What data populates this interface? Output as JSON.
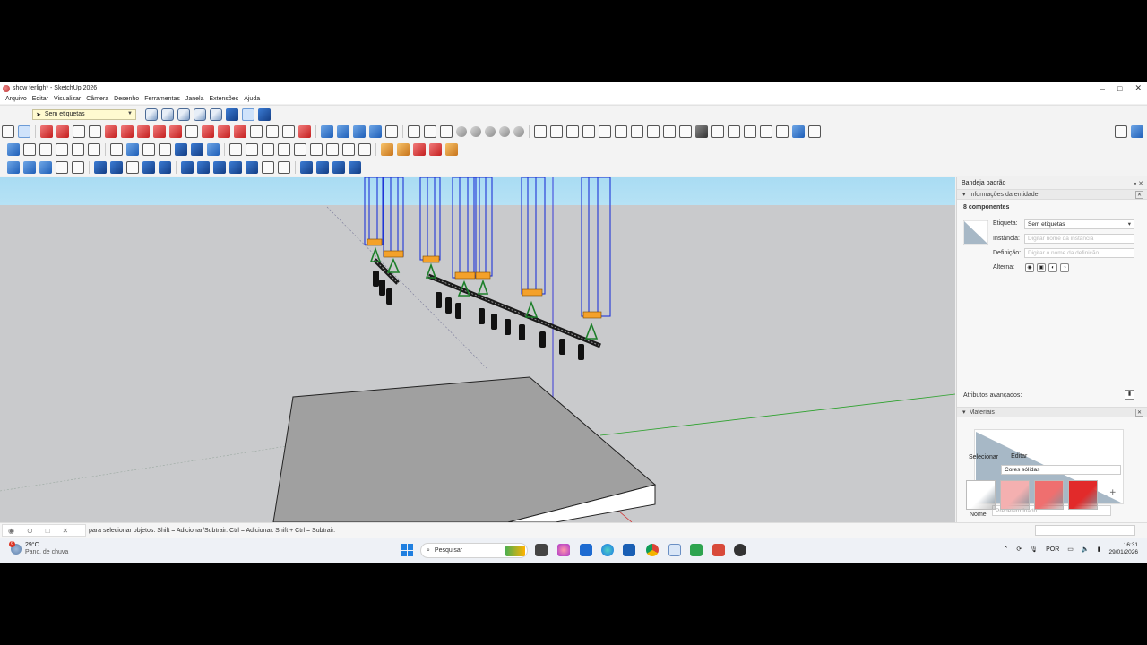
{
  "window": {
    "title": "show ferligh* - SketchUp 2026"
  },
  "menu": [
    "Arquivo",
    "Editar",
    "Visualizar",
    "Câmera",
    "Desenho",
    "Ferramentas",
    "Janela",
    "Extensões",
    "Ajuda"
  ],
  "toolbar": {
    "tag_select_value": "Sem etiquetas"
  },
  "status": {
    "hint": "para selecionar objetos. Shift = Adicionar/Subtrair. Ctrl = Adicionar. Shift + Ctrl = Subtrair."
  },
  "tray": {
    "title": "Bandeja padrão",
    "entity_panel": {
      "title": "Informações da entidade",
      "count": "8 componentes",
      "tag_label": "Etiqueta:",
      "tag_value": "Sem etiquetas",
      "instance_label": "Instância:",
      "instance_placeholder": "Digitar nome da instância",
      "definition_label": "Definição:",
      "definition_placeholder": "Digitar o nome da definição",
      "toggles_label": "Alterna:",
      "advanced_label": "Atributos avançados:"
    },
    "materials_panel": {
      "title": "Materiais",
      "name_label": "Nome",
      "name_placeholder": "Predeterminado",
      "tab_select": "Selecionar",
      "tab_edit": "Editar",
      "library": "Cores sólidas",
      "swatches": [
        "#ffffff",
        "#f4b0b0",
        "#ef6f6f",
        "#e22a2a"
      ]
    }
  },
  "taskbar": {
    "weather_temp": "29°C",
    "weather_desc": "Panc. de chuva",
    "weather_badge": "6",
    "search_placeholder": "Pesquisar",
    "lang": "POR",
    "time": "16:31",
    "date": "29/01/2026"
  }
}
